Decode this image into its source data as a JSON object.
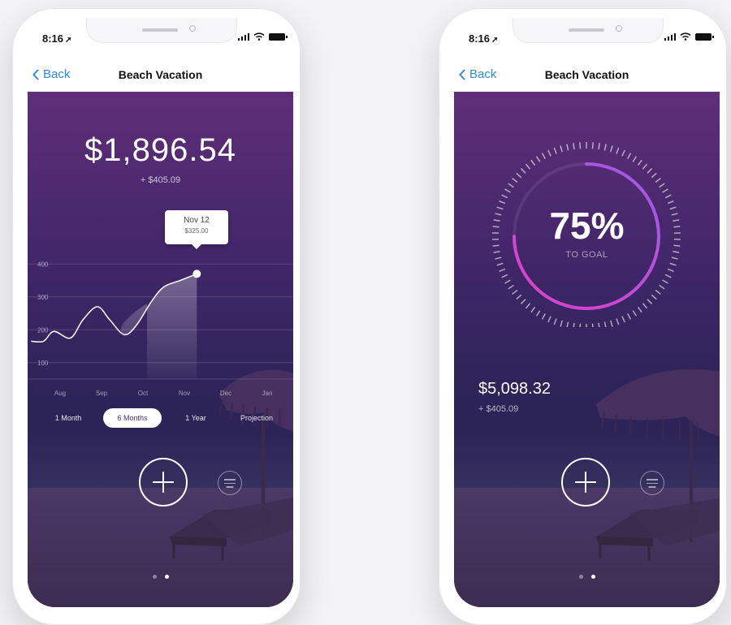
{
  "status_bar": {
    "time": "8:16",
    "location_arrow": "location-arrow-icon"
  },
  "nav": {
    "back_label": "Back",
    "title": "Beach Vacation"
  },
  "left_screen": {
    "amount": "$1,896.54",
    "change": "+ $405.09",
    "tooltip": {
      "date": "Nov 12",
      "value": "$325.00"
    },
    "range_tabs": [
      {
        "label": "1 Month",
        "active": false
      },
      {
        "label": "6 Months",
        "active": true
      },
      {
        "label": "1 Year",
        "active": false
      },
      {
        "label": "Projection",
        "active": false
      }
    ],
    "page_dots": {
      "count": 2,
      "active_index": 1
    }
  },
  "right_screen": {
    "progress_percent": "75%",
    "progress_value": 0.75,
    "progress_label": "TO GOAL",
    "balance": "$5,098.32",
    "change": "+ $405.09",
    "page_dots": {
      "count": 2,
      "active_index": 1
    }
  },
  "colors": {
    "accent_blue": "#2e8ae6",
    "bg_top": "#602e79",
    "bg_bottom": "#2c2650",
    "ring_start": "#e040c8",
    "ring_end": "#9a5ce8"
  },
  "chart_data": {
    "type": "line",
    "categories": [
      "Aug",
      "Sep",
      "Oct",
      "Nov",
      "Dec",
      "Jan"
    ],
    "y_ticks": [
      100,
      200,
      300,
      400
    ],
    "ylim": [
      50,
      450
    ],
    "series": [
      {
        "x_index": [
          -0.7,
          -0.4,
          -0.15,
          0.25,
          0.55,
          0.9,
          1.2,
          1.55,
          1.85,
          2.2,
          2.5,
          2.9,
          3.3
        ],
        "values": [
          165,
          165,
          195,
          175,
          230,
          270,
          230,
          185,
          215,
          285,
          330,
          350,
          370
        ]
      }
    ],
    "highlight": {
      "date": "Nov 12",
      "value": 325.0
    },
    "grid": true
  }
}
